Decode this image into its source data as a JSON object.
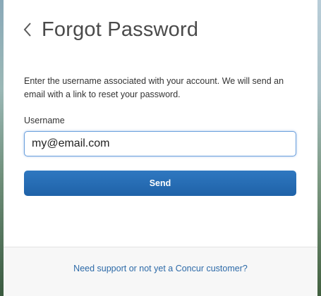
{
  "page": {
    "title": "Forgot Password",
    "description": "Enter the username associated with your account. We will send an email with a link to reset your password.",
    "back_icon": "chevron-left-icon"
  },
  "form": {
    "username_label": "Username",
    "username_value": "my@email.com",
    "send_label": "Send"
  },
  "footer": {
    "support_link": "Need support or not yet a Concur customer?"
  },
  "colors": {
    "primary_button": "#1f62a8",
    "link": "#2d6aa8",
    "input_focus_border": "#6a9fdc"
  }
}
